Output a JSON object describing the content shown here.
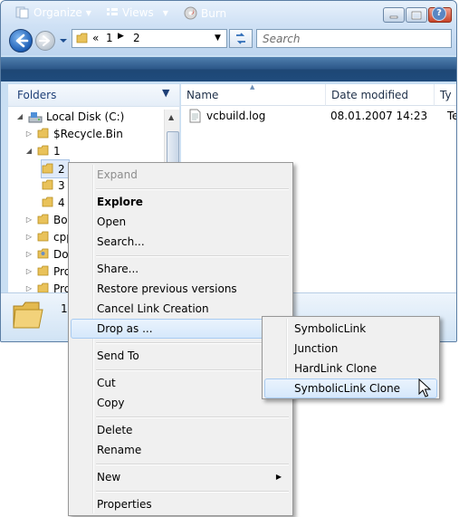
{
  "address": {
    "chevron": "«",
    "segments": [
      "1",
      "2"
    ]
  },
  "search": {
    "placeholder": "Search"
  },
  "toolbar": {
    "organize": "Organize",
    "views": "Views",
    "burn": "Burn"
  },
  "tree": {
    "title": "Folders",
    "items": [
      {
        "label": "Local Disk (C:)",
        "icon": "drive-icon"
      },
      {
        "label": "$Recycle.Bin",
        "icon": "folder-icon"
      },
      {
        "label": "1",
        "icon": "folder-icon"
      },
      {
        "label": "2",
        "icon": "folder-icon",
        "selected": true
      },
      {
        "label": "3",
        "icon": "folder-icon"
      },
      {
        "label": "4",
        "icon": "folder-icon"
      },
      {
        "label": "Boo",
        "icon": "folder-icon"
      },
      {
        "label": "cpp",
        "icon": "folder-icon"
      },
      {
        "label": "Doc",
        "icon": "folder-icon"
      },
      {
        "label": "Pro",
        "icon": "folder-icon"
      },
      {
        "label": "Pro",
        "icon": "folder-icon"
      }
    ]
  },
  "list": {
    "columns": [
      "Name",
      "Date modified",
      "Ty"
    ],
    "rows": [
      {
        "name": "vcbuild.log",
        "date": "08.01.2007 14:23",
        "type": "Te"
      }
    ]
  },
  "details": {
    "count": "1"
  },
  "context_menu": {
    "items": [
      "Expand",
      "Explore",
      "Open",
      "Search...",
      "Share...",
      "Restore previous versions",
      "Cancel Link Creation",
      "Drop as ...",
      "Send To",
      "Cut",
      "Copy",
      "Delete",
      "Rename",
      "New",
      "Properties"
    ]
  },
  "drop_submenu": {
    "items": [
      "SymbolicLink",
      "Junction",
      "HardLink Clone",
      "SymbolicLink Clone"
    ]
  },
  "colors": {
    "toolbar": "#2b5687",
    "highlight": "#d6e8fb",
    "menu_bg": "#f0f0f0"
  }
}
